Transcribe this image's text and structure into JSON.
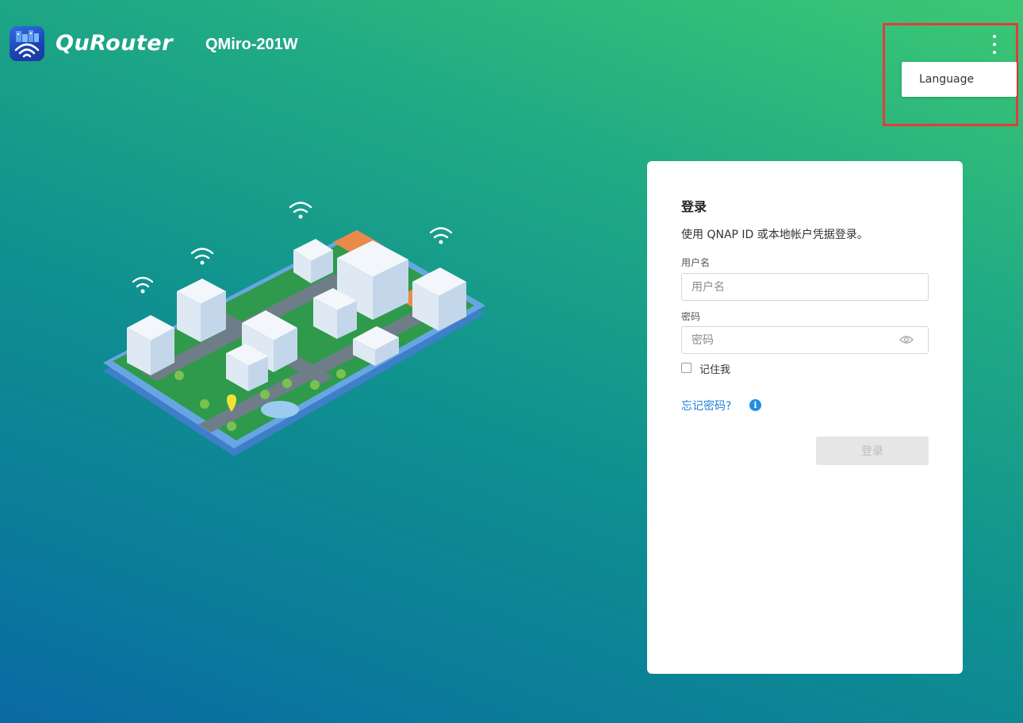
{
  "header": {
    "app_name": "QuRouter",
    "device_name": "QMiro-201W",
    "icons": {
      "app_logo": "router-app-logo-icon",
      "menu": "kebab-menu-icon"
    }
  },
  "menu": {
    "items": [
      {
        "label": "Language"
      }
    ]
  },
  "login": {
    "title": "登录",
    "description": "使用 QNAP ID 或本地帐户凭据登录。",
    "username": {
      "label": "用户名",
      "placeholder": "用户名",
      "value": ""
    },
    "password": {
      "label": "密码",
      "placeholder": "密码",
      "value": ""
    },
    "remember_me": "记住我",
    "forgot_password": "忘记密码?",
    "submit_label": "登录"
  },
  "colors": {
    "gradient_top": "#3cc873",
    "gradient_bottom": "#0a6aa4",
    "link": "#2382d9",
    "highlight": "#e53b3b",
    "button_disabled_bg": "#e6e6e6",
    "button_disabled_text": "#bdbdbd"
  }
}
